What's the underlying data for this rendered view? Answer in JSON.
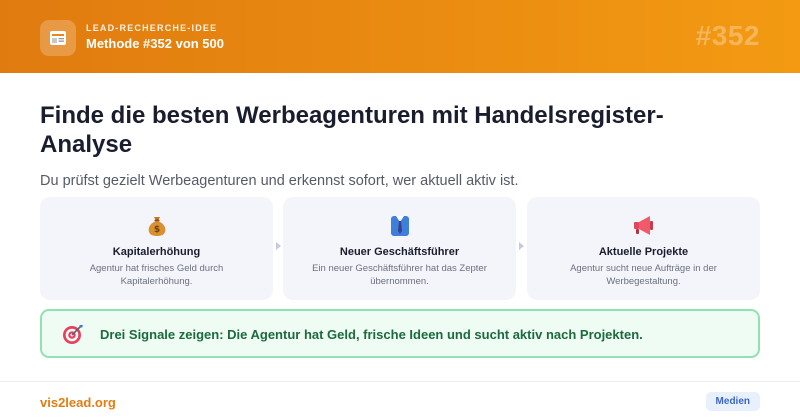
{
  "header": {
    "icon": "newspaper-icon",
    "kicker": "LEAD-RECHERCHE-IDEE",
    "method": "Methode #352 von 500",
    "number": "#352",
    "gradient": [
      "#e07b10",
      "#f39a12"
    ]
  },
  "main": {
    "title": "Finde die besten Werbeagenturen mit Handelsregister-Analyse",
    "subtitle": "Du prüfst gezielt Werbeagenturen und erkennst sofort, wer aktuell aktiv ist."
  },
  "cards": [
    {
      "icon": "money-bag-icon",
      "title": "Kapitalerhöhung",
      "desc": "Agentur hat frisches Geld durch Kapitalerhöhung."
    },
    {
      "icon": "suit-tie-icon",
      "title": "Neuer Geschäftsführer",
      "desc": "Ein neuer Geschäftsführer hat das Zepter übernommen."
    },
    {
      "icon": "megaphone-icon",
      "title": "Aktuelle Projekte",
      "desc": "Agentur sucht neue Aufträge in der Werbegestaltung."
    }
  ],
  "result": {
    "icon": "target-icon",
    "text": "Drei Signale zeigen: Die Agentur hat Geld, frische Ideen und sucht aktiv nach Projekten."
  },
  "footer": {
    "brand": "vis2lead.org",
    "badge": "Medien"
  },
  "colors": {
    "accent": "#e27d12",
    "success_border": "#8ee3b0",
    "success_bg": "#eefcf3",
    "badge_bg": "#e8f0fd"
  }
}
